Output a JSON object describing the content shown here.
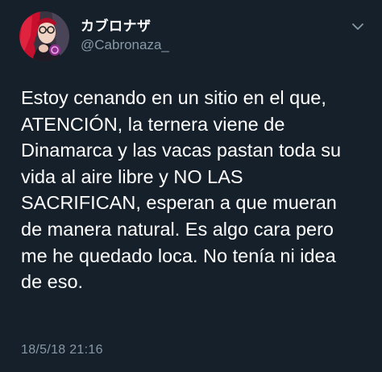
{
  "tweet": {
    "display_name": "カブロナザ",
    "handle": "@Cabronaza_",
    "text_lines": [
      "Estoy cenando en un sitio en el que,",
      "ATENCIÓN, la ternera viene de",
      "Dinamarca y las vacas pastan toda su",
      "vida al aire libre y NO LAS",
      "SACRIFICAN, esperan a que mueran",
      "de manera natural. Es algo cara pero",
      "me he quedado loca. No tenía ni idea",
      "de eso."
    ],
    "timestamp": "18/5/18 21:16"
  },
  "colors": {
    "background": "#15202b",
    "primary_text": "#ffffff",
    "secondary_text": "#8899a6"
  },
  "icons": {
    "menu": "chevron-down-icon"
  }
}
